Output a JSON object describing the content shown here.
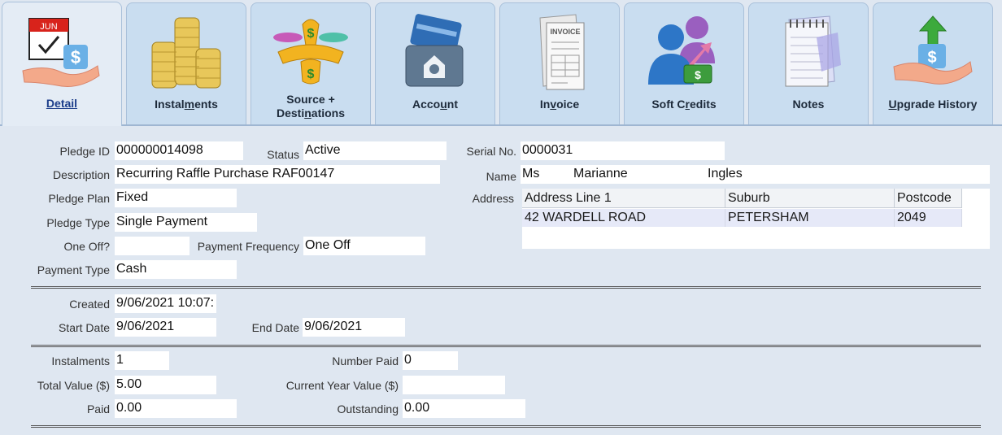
{
  "tabs": [
    {
      "id": "detail",
      "pre": "",
      "u": "D",
      "post": "etail",
      "icon": "calendar-money-hand-icon"
    },
    {
      "id": "instalments",
      "pre": "Instal",
      "u": "m",
      "post": "ents",
      "icon": "coin-stacks-icon"
    },
    {
      "id": "source",
      "line1": "Source +",
      "pre": "Desti",
      "u": "n",
      "post": "ations",
      "icon": "money-distribution-icon"
    },
    {
      "id": "account",
      "pre": "Acco",
      "u": "u",
      "post": "nt",
      "icon": "credit-card-safe-icon"
    },
    {
      "id": "invoice",
      "pre": "In",
      "u": "v",
      "post": "oice",
      "icon": "invoice-icon"
    },
    {
      "id": "soft-credits",
      "pre": "Soft C",
      "u": "r",
      "post": "edits",
      "icon": "people-money-icon"
    },
    {
      "id": "notes",
      "pre": "Notes",
      "u": "",
      "post": "",
      "icon": "notepad-icon"
    },
    {
      "id": "upgrade-history",
      "pre": "",
      "u": "U",
      "post": "pgrade History",
      "icon": "money-upgrade-icon"
    }
  ],
  "icon_text": {
    "calendar_month": "JUN",
    "invoice_title": "INVOICE"
  },
  "labels": {
    "pledge_id": "Pledge ID",
    "status": "Status",
    "serial_no": "Serial No.",
    "description": "Description",
    "name": "Name",
    "pledge_plan": "Pledge Plan",
    "address": "Address",
    "pledge_type": "Pledge Type",
    "one_off": "One Off?",
    "payment_frequency": "Payment Frequency",
    "payment_type": "Payment Type",
    "created": "Created",
    "start_date": "Start Date",
    "end_date": "End Date",
    "instalments": "Instalments",
    "number_paid": "Number Paid",
    "total_value": "Total Value ($)",
    "current_year_value": "Current Year Value ($)",
    "paid": "Paid",
    "outstanding": "Outstanding"
  },
  "values": {
    "pledge_id": "000000014098",
    "status": "Active",
    "serial_no": "0000031",
    "description": "Recurring Raffle Purchase RAF00147",
    "name_title": "Ms",
    "name_first": "Marianne",
    "name_last": "Ingles",
    "pledge_plan": "Fixed",
    "pledge_type": "Single Payment",
    "one_off": "",
    "payment_frequency": "One Off",
    "payment_type": "Cash",
    "created": "9/06/2021 10:07:",
    "start_date": "9/06/2021",
    "end_date": "9/06/2021",
    "instalments": "1",
    "number_paid": "0",
    "total_value": "5.00",
    "current_year_value": "",
    "paid": "0.00",
    "outstanding": "0.00"
  },
  "address_table": {
    "headers": [
      "Address Line 1",
      "Suburb",
      "Postcode"
    ],
    "rows": [
      [
        "42 WARDELL ROAD",
        "PETERSHAM",
        "2049"
      ]
    ]
  }
}
